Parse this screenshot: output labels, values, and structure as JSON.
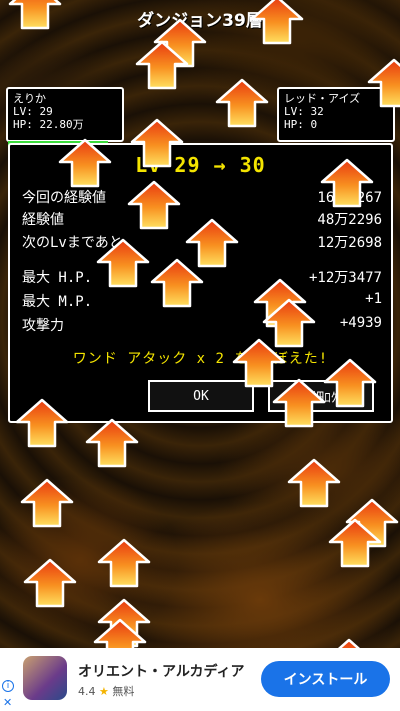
{
  "screen": {
    "title": "ダンジョン39層"
  },
  "party": [
    {
      "name": "えりか",
      "lv": "LV: 29",
      "hp": "HP: 22.80万",
      "hp_fraction": 0.85
    },
    {
      "name": "レッド・アイズ",
      "lv": "LV: 32",
      "hp": "HP: 0",
      "hp_fraction": 0
    }
  ],
  "result": {
    "level_up": "Lv 29 →  30",
    "stats": [
      {
        "label": "今回の経験値",
        "value": "16万9267"
      },
      {
        "label": "経験値",
        "value": "48万2296"
      },
      {
        "label": "次のLvまであと",
        "value": "12万2698"
      },
      {
        "label": "最大 H.P.",
        "value": "+12万3477"
      },
      {
        "label": "最大 M.P.",
        "value": "+1"
      },
      {
        "label": "攻撃力",
        "value": "+4939"
      }
    ],
    "learned": "ワンド アタック x 2 を おぼえた!",
    "ok_label": "OK",
    "detail_label": "詳細ﾛｸﾞ"
  },
  "ad": {
    "title": "オリエント・アルカディア",
    "rating": "4.4",
    "star": "★",
    "price": "無料",
    "install_label": "インストール",
    "info_icon": "i",
    "close_icon": "✕"
  },
  "colors": {
    "accent": "#f4e400",
    "hp_bar": "#3cdc3c",
    "install": "#1a73e8"
  }
}
